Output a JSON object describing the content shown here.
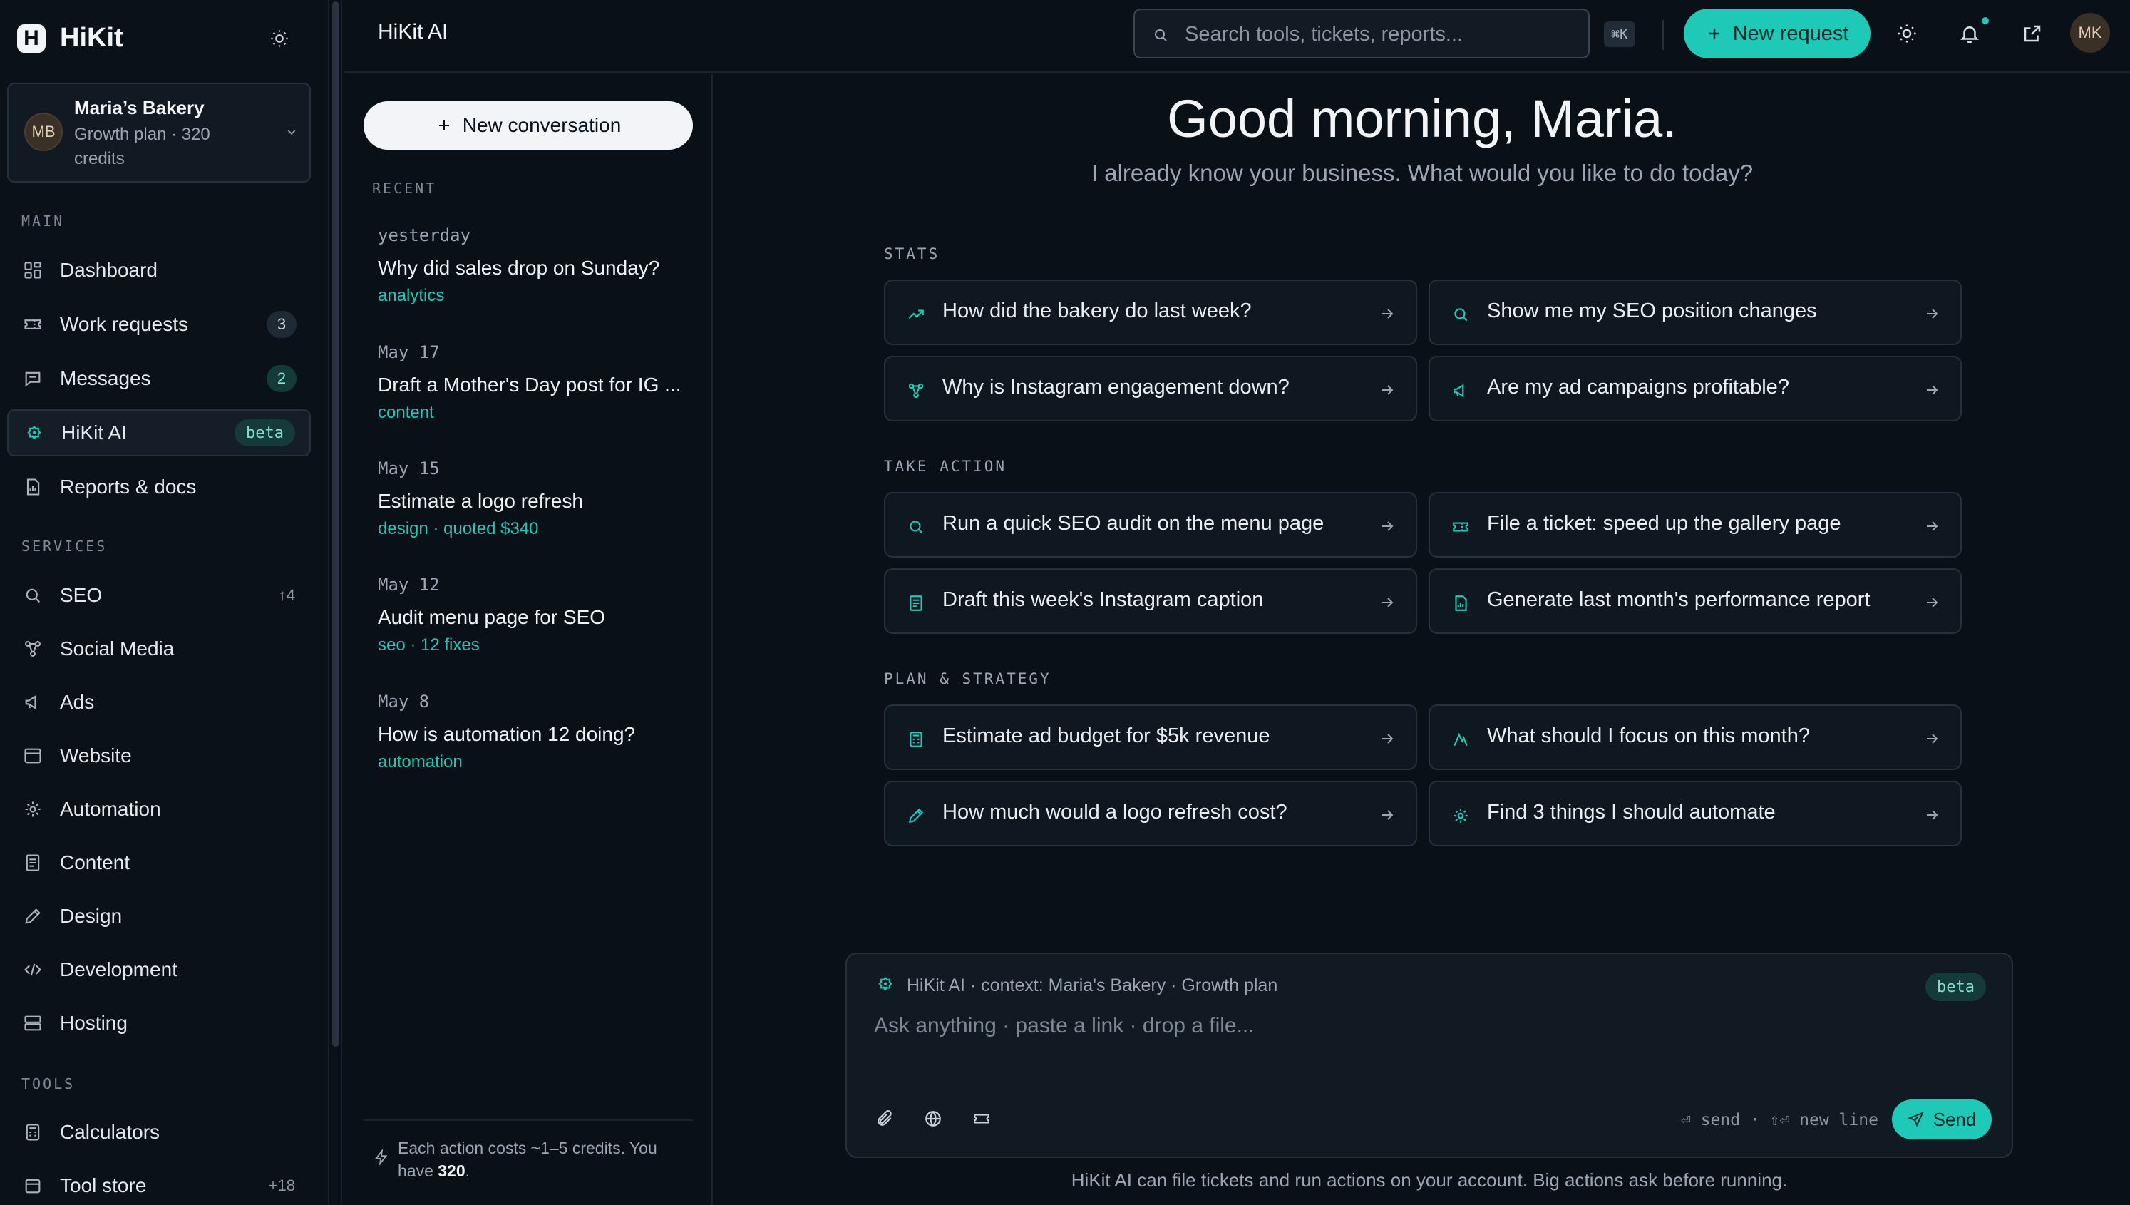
{
  "brand": {
    "name": "HiKit",
    "logo_letter": "H"
  },
  "account": {
    "initials": "MB",
    "name": "Maria’s Bakery",
    "plan": "Growth plan · 320 credits"
  },
  "sidebar": {
    "main_label": "MAIN",
    "main_items": [
      {
        "label": "Dashboard",
        "icon": "grid-icon"
      },
      {
        "label": "Work requests",
        "icon": "ticket-icon",
        "count": "3"
      },
      {
        "label": "Messages",
        "icon": "chat-icon",
        "count": "2"
      },
      {
        "label": "HiKit AI",
        "icon": "ai-icon",
        "badge": "beta",
        "active": true
      },
      {
        "label": "Reports & docs",
        "icon": "report-icon"
      }
    ],
    "services_label": "SERVICES",
    "services_items": [
      {
        "label": "SEO",
        "icon": "search-icon",
        "extra": "↑4"
      },
      {
        "label": "Social Media",
        "icon": "network-icon"
      },
      {
        "label": "Ads",
        "icon": "megaphone-icon"
      },
      {
        "label": "Website",
        "icon": "browser-icon"
      },
      {
        "label": "Automation",
        "icon": "cog-icon"
      },
      {
        "label": "Content",
        "icon": "document-icon"
      },
      {
        "label": "Design",
        "icon": "pen-icon"
      },
      {
        "label": "Development",
        "icon": "code-icon"
      },
      {
        "label": "Hosting",
        "icon": "server-icon"
      }
    ],
    "tools_label": "TOOLS",
    "tools_items": [
      {
        "label": "Calculators",
        "icon": "calculator-icon"
      },
      {
        "label": "Tool store",
        "icon": "store-icon",
        "extra": "+18"
      }
    ]
  },
  "topbar": {
    "title": "HiKit AI",
    "search_placeholder": "Search tools, tickets, reports...",
    "shortcut": "⌘K",
    "new_request": "New request",
    "avatar": "MK"
  },
  "conversations": {
    "new_label": "New conversation",
    "recent_label": "RECENT",
    "items": [
      {
        "date": "yesterday",
        "title": "Why did sales drop on Sunday?",
        "tag": "analytics"
      },
      {
        "date": "May 17",
        "title": "Draft a Mother's Day post for IG ...",
        "tag": "content"
      },
      {
        "date": "May 15",
        "title": "Estimate a logo refresh",
        "tag": "design · quoted $340"
      },
      {
        "date": "May 12",
        "title": "Audit menu page for SEO",
        "tag": "seo · 12 fixes"
      },
      {
        "date": "May 8",
        "title": "How is automation 12 doing?",
        "tag": "automation"
      }
    ],
    "credits_note_prefix": "Each action costs ~1–5 credits. You have ",
    "credits_value": "320",
    "credits_note_suffix": "."
  },
  "main": {
    "greeting": "Good morning, Maria.",
    "subtitle": "I already know your business. What would you like to do today?",
    "groups": [
      {
        "label": "STATS",
        "cards": [
          {
            "label": "How did the bakery do last week?",
            "icon": "trend-icon"
          },
          {
            "label": "Show me my SEO position changes",
            "icon": "search-icon"
          },
          {
            "label": "Why is Instagram engagement down?",
            "icon": "network-icon"
          },
          {
            "label": "Are my ad campaigns profitable?",
            "icon": "megaphone-icon"
          }
        ]
      },
      {
        "label": "TAKE ACTION",
        "cards": [
          {
            "label": "Run a quick SEO audit on the menu page",
            "icon": "search-icon"
          },
          {
            "label": "File a ticket: speed up the gallery page",
            "icon": "ticket-icon"
          },
          {
            "label": "Draft this week's Instagram caption",
            "icon": "document-icon"
          },
          {
            "label": "Generate last month's performance report",
            "icon": "report-icon"
          }
        ]
      },
      {
        "label": "PLAN & STRATEGY",
        "cards": [
          {
            "label": "Estimate ad budget for $5k revenue",
            "icon": "calculator-icon"
          },
          {
            "label": "What should I focus on this month?",
            "icon": "target-icon"
          },
          {
            "label": "How much would a logo refresh cost?",
            "icon": "pen-icon"
          },
          {
            "label": "Find 3 things I should automate",
            "icon": "cog-icon"
          }
        ]
      }
    ]
  },
  "composer": {
    "context": "HiKit AI · context: Maria's Bakery · Growth plan",
    "badge": "beta",
    "placeholder": "Ask anything · paste a link · drop a file...",
    "hint": "⏎ send · ⇧⏎ new line",
    "send": "Send"
  },
  "footnote": "HiKit AI can file tickets and run actions on your account. Big actions ask before running.",
  "colors": {
    "accent": "#1ec9b7",
    "background": "#0a1018",
    "border": "#27313d"
  }
}
